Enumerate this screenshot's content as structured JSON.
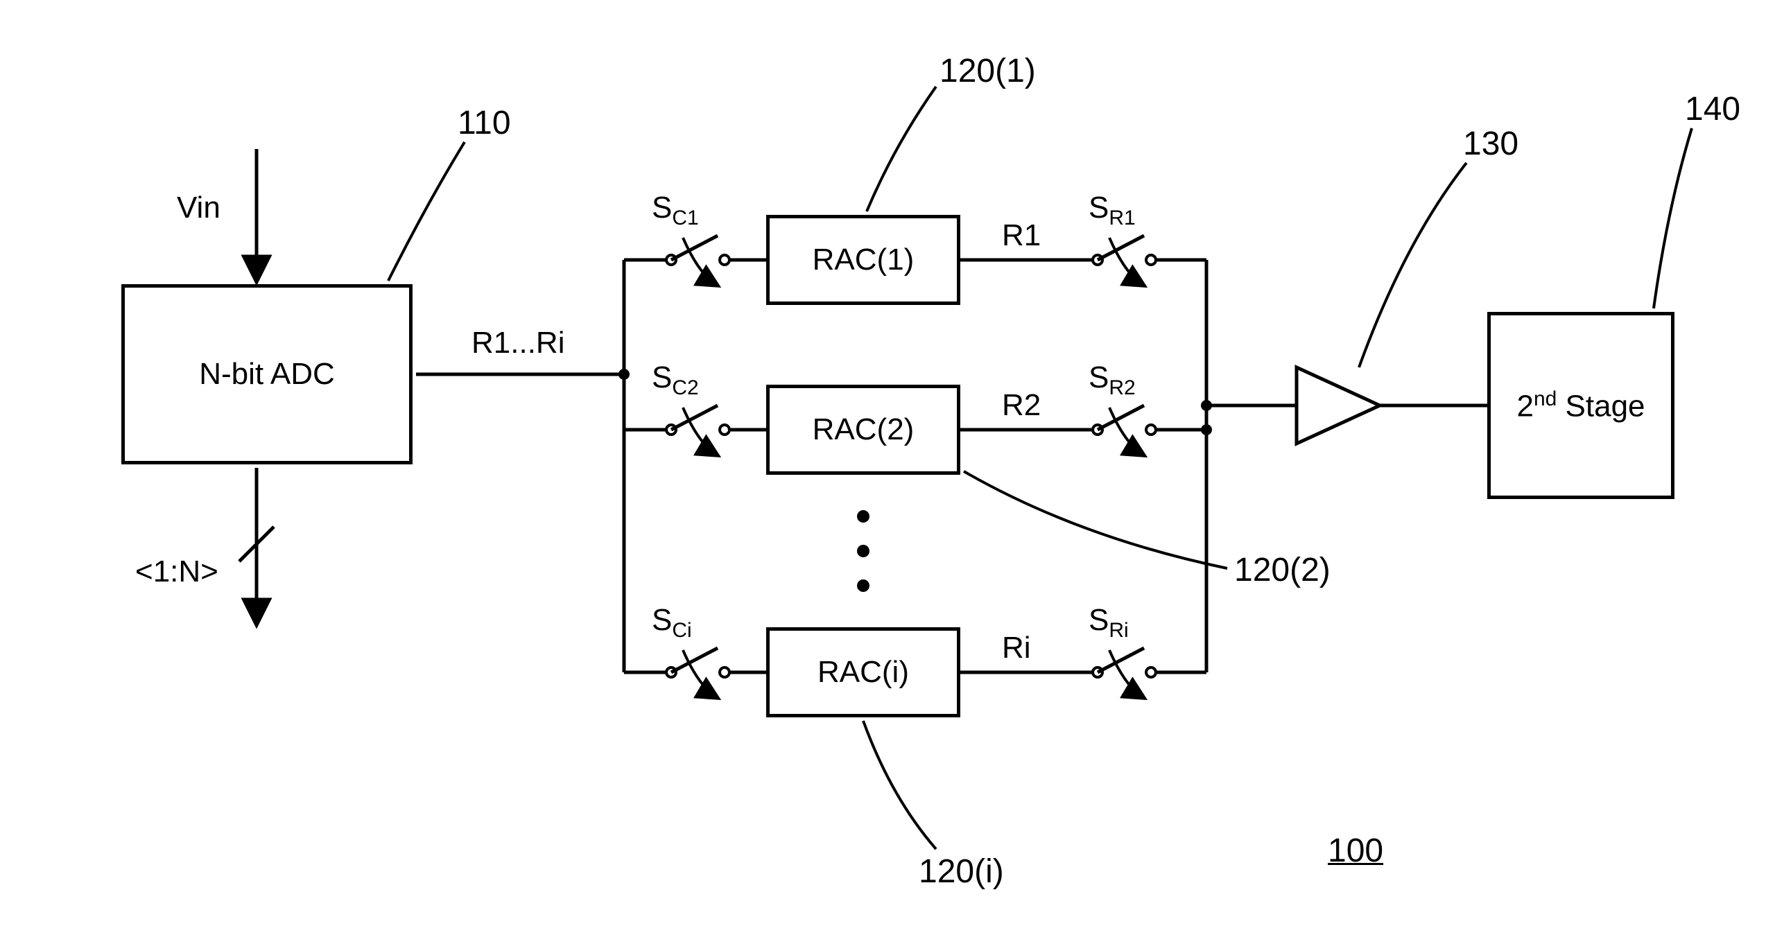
{
  "blocks": {
    "adc": "N-bit ADC",
    "rac1": "RAC(1)",
    "rac2": "RAC(2)",
    "raci": "RAC(i)",
    "stage2_prefix": "2",
    "stage2_sup": "nd",
    "stage2_suffix": " Stage"
  },
  "signals": {
    "vin": "Vin",
    "bus": "R1...Ri",
    "out_adc": "<1:N>",
    "r1": "R1",
    "r2": "R2",
    "ri": "Ri"
  },
  "switches": {
    "sc1_pre": "S",
    "sc1_sub": "C1",
    "sc2_pre": "S",
    "sc2_sub": "C2",
    "sci_pre": "S",
    "sci_sub": "Ci",
    "sr1_pre": "S",
    "sr1_sub": "R1",
    "sr2_pre": "S",
    "sr2_sub": "R2",
    "sri_pre": "S",
    "sri_sub": "Ri"
  },
  "refs": {
    "r110": "110",
    "r120_1": "120(1)",
    "r120_2": "120(2)",
    "r120_i": "120(i)",
    "r130": "130",
    "r140": "140",
    "r100": "100"
  }
}
